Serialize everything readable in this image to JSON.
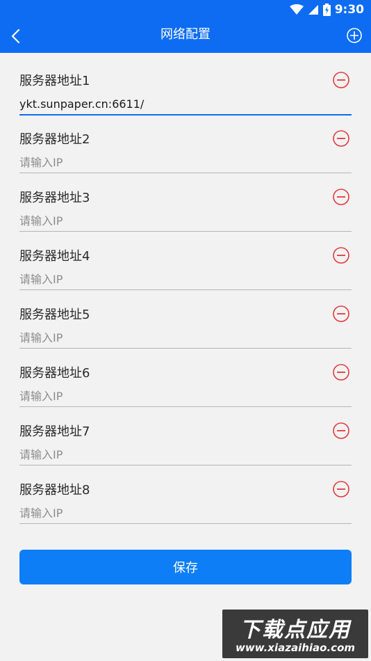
{
  "status_bar": {
    "time": "9:30"
  },
  "header": {
    "title": "网络配置",
    "back_icon": "chevron-left-icon",
    "add_icon": "plus-circle-icon"
  },
  "colors": {
    "primary": "#0d6cf2",
    "button": "#0d7ef5",
    "remove": "#e5383b",
    "background": "#f2f2f2"
  },
  "fields": [
    {
      "label": "服务器地址1",
      "value": "ykt.sunpaper.cn:6611/",
      "placeholder": "请输入IP"
    },
    {
      "label": "服务器地址2",
      "value": "",
      "placeholder": "请输入IP"
    },
    {
      "label": "服务器地址3",
      "value": "",
      "placeholder": "请输入IP"
    },
    {
      "label": "服务器地址4",
      "value": "",
      "placeholder": "请输入IP"
    },
    {
      "label": "服务器地址5",
      "value": "",
      "placeholder": "请输入IP"
    },
    {
      "label": "服务器地址6",
      "value": "",
      "placeholder": "请输入IP"
    },
    {
      "label": "服务器地址7",
      "value": "",
      "placeholder": "请输入IP"
    },
    {
      "label": "服务器地址8",
      "value": "",
      "placeholder": "请输入IP"
    }
  ],
  "save_button": {
    "label": "保存"
  },
  "watermark": {
    "title": "下载点应用",
    "url": "www.xiazaihiao.com"
  }
}
